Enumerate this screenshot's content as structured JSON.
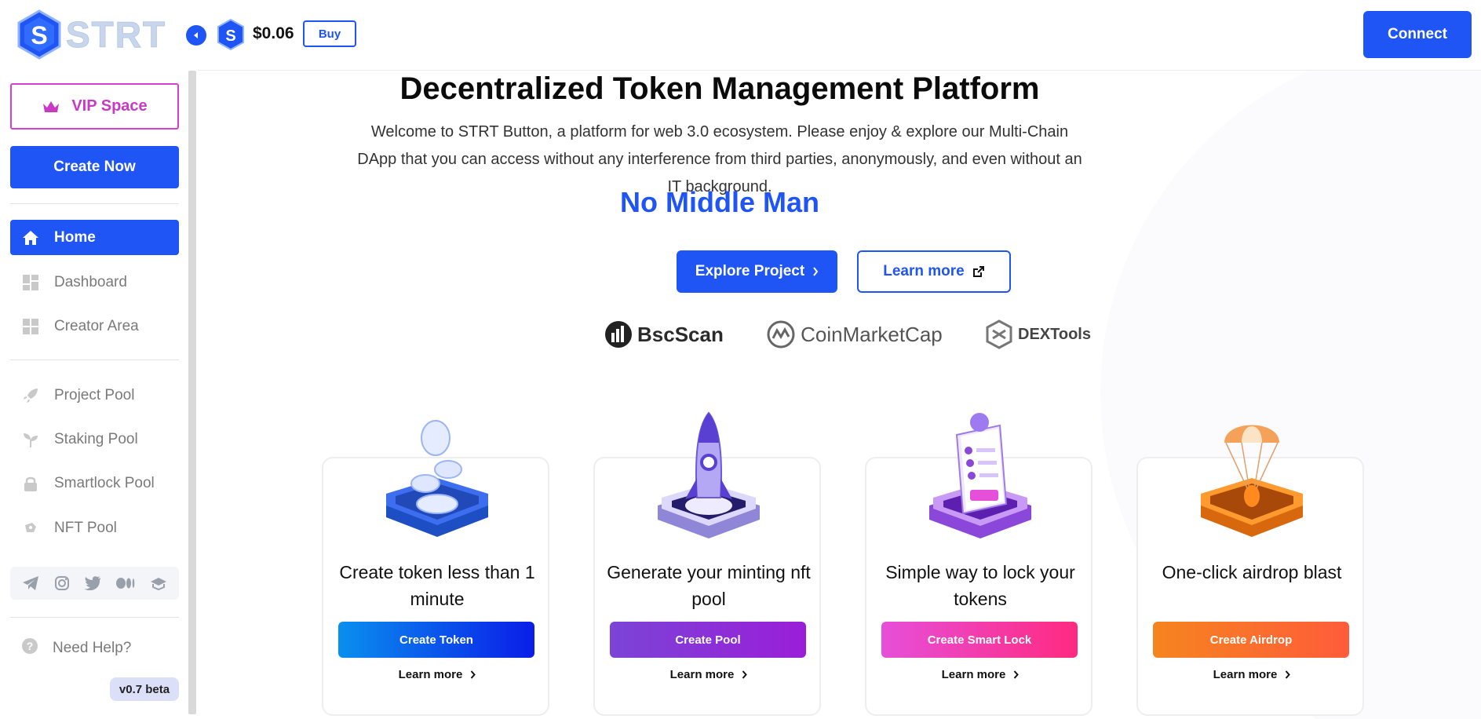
{
  "brand": {
    "logo_text": "STRT",
    "logo_letter": "S"
  },
  "header": {
    "price": "$0.06",
    "buy_label": "Buy",
    "connect_label": "Connect"
  },
  "sidebar": {
    "vip_label": "VIP Space",
    "create_label": "Create Now",
    "nav_main": [
      {
        "label": "Home",
        "icon": "home-icon",
        "active": true
      },
      {
        "label": "Dashboard",
        "icon": "dashboard-icon",
        "active": false
      },
      {
        "label": "Creator Area",
        "icon": "grid-icon",
        "active": false
      }
    ],
    "nav_pools": [
      {
        "label": "Project Pool",
        "icon": "rocket-icon"
      },
      {
        "label": "Staking Pool",
        "icon": "sprout-icon"
      },
      {
        "label": "Smartlock Pool",
        "icon": "lock-icon"
      },
      {
        "label": "NFT Pool",
        "icon": "nft-icon"
      }
    ],
    "socials": [
      "telegram-icon",
      "instagram-icon",
      "twitter-icon",
      "medium-icon",
      "docs-icon"
    ],
    "help_label": "Need Help?",
    "version": "v0.7 beta"
  },
  "hero": {
    "title": "Decentralized Token Management Platform",
    "description": "Welcome to STRT Button, a platform for web 3.0 ecosystem. Please enjoy & explore our Multi-Chain DApp that you can access without any interference from third parties, anonymously, and even without an IT background.",
    "tagline": "No Middle Man",
    "explore_label": "Explore Project",
    "learn_label": "Learn more"
  },
  "partners": [
    {
      "name": "BscScan",
      "icon": "bscscan-icon"
    },
    {
      "name": "CoinMarketCap",
      "icon": "coinmarketcap-icon"
    },
    {
      "name": "DEXTools",
      "icon": "dextools-icon"
    }
  ],
  "cards": [
    {
      "title": "Create token less than 1 minute",
      "button": "Create Token",
      "learn": "Learn more",
      "color_from": "#0a8fee",
      "color_to": "#0a1de8",
      "illus": "coins"
    },
    {
      "title": "Generate your minting nft pool",
      "button": "Create Pool",
      "learn": "Learn more",
      "color_from": "#7b44d6",
      "color_to": "#9a1ed8",
      "illus": "rocket"
    },
    {
      "title": "Simple way to lock your tokens",
      "button": "Create Smart Lock",
      "learn": "Learn more",
      "color_from": "#e64fd9",
      "color_to": "#ff2a80",
      "illus": "document"
    },
    {
      "title": "One-click airdrop blast",
      "button": "Create Airdrop",
      "learn": "Learn more",
      "color_from": "#f5841f",
      "color_to": "#ff5c3a",
      "illus": "parachute"
    }
  ],
  "colors": {
    "accent": "#1f55f5",
    "vip": "#c83ac4"
  }
}
